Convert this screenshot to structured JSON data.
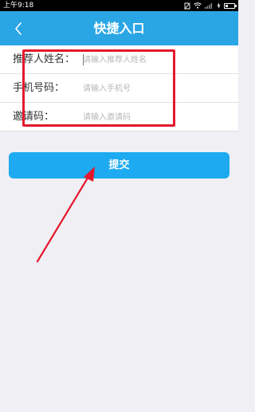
{
  "status_bar": {
    "time": "上午9:18"
  },
  "header": {
    "title": "快捷入口",
    "back_icon": "chevron-left-icon"
  },
  "form": {
    "fields": [
      {
        "label": "推荐人姓名：",
        "placeholder": "请输入推荐人姓名",
        "value": ""
      },
      {
        "label": "手机号码：",
        "placeholder": "请输入手机号",
        "value": ""
      },
      {
        "label": "邀请码：",
        "placeholder": "请输入邀请码",
        "value": ""
      }
    ]
  },
  "submit": {
    "label": "提交"
  },
  "annotation": {
    "color": "#e4182d"
  },
  "colors": {
    "nav_bar": "#2aa6e4",
    "button": "#1daaf0",
    "background": "#efeff4"
  }
}
